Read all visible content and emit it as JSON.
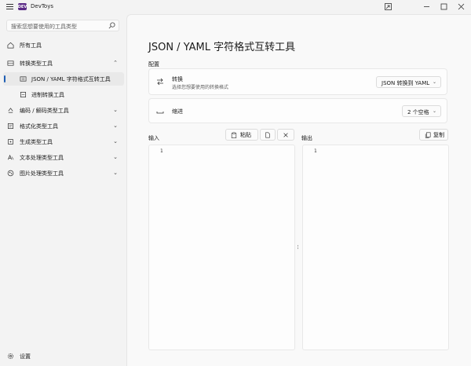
{
  "app": {
    "title": "DevToys",
    "logo_text": "DEV"
  },
  "search": {
    "placeholder": "搜索您想要使用的工具类型"
  },
  "sidebar": {
    "all_tools": "所有工具",
    "items": [
      {
        "label": "转换类型工具",
        "icon": "convert-icon",
        "expanded": true
      },
      {
        "label": "JSON / YAML 字符格式互转工具",
        "icon": "json-icon",
        "selected": true
      },
      {
        "label": "进制转换工具",
        "icon": "number-base-icon"
      },
      {
        "label": "编码 / 解码类型工具",
        "icon": "encode-icon"
      },
      {
        "label": "格式化类型工具",
        "icon": "format-icon"
      },
      {
        "label": "生成类型工具",
        "icon": "generate-icon"
      },
      {
        "label": "文本处理类型工具",
        "icon": "text-icon"
      },
      {
        "label": "图片处理类型工具",
        "icon": "image-icon"
      }
    ],
    "settings": "设置"
  },
  "main": {
    "title": "JSON / YAML 字符格式互转工具",
    "config_label": "配置",
    "conversion": {
      "title": "转换",
      "description": "选择您想要使用的转换格式",
      "value": "JSON 转换到 YAML"
    },
    "indent": {
      "title": "缩进",
      "value": "2 个空格"
    },
    "input": {
      "label": "输入",
      "paste_label": "粘贴",
      "line_number": "1"
    },
    "output": {
      "label": "输出",
      "copy_label": "复制",
      "line_number": "1"
    }
  },
  "colors": {
    "accent": "#1f5fb4",
    "logo": "#5b2a86"
  }
}
